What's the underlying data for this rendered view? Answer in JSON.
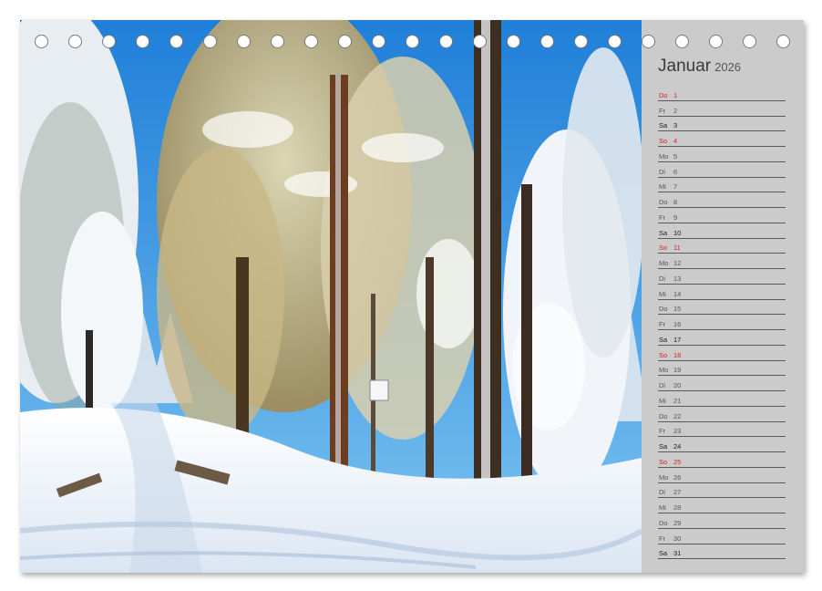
{
  "calendar": {
    "month": "Januar",
    "year": "2026",
    "days": [
      {
        "dn": "Do",
        "d": "1",
        "type": "sun"
      },
      {
        "dn": "Fr",
        "d": "2",
        "type": ""
      },
      {
        "dn": "Sa",
        "d": "3",
        "type": "sat"
      },
      {
        "dn": "So",
        "d": "4",
        "type": "sun"
      },
      {
        "dn": "Mo",
        "d": "5",
        "type": ""
      },
      {
        "dn": "Di",
        "d": "6",
        "type": ""
      },
      {
        "dn": "Mi",
        "d": "7",
        "type": ""
      },
      {
        "dn": "Do",
        "d": "8",
        "type": ""
      },
      {
        "dn": "Fr",
        "d": "9",
        "type": ""
      },
      {
        "dn": "Sa",
        "d": "10",
        "type": "sat"
      },
      {
        "dn": "So",
        "d": "11",
        "type": "sun"
      },
      {
        "dn": "Mo",
        "d": "12",
        "type": ""
      },
      {
        "dn": "Di",
        "d": "13",
        "type": ""
      },
      {
        "dn": "Mi",
        "d": "14",
        "type": ""
      },
      {
        "dn": "Do",
        "d": "15",
        "type": ""
      },
      {
        "dn": "Fr",
        "d": "16",
        "type": ""
      },
      {
        "dn": "Sa",
        "d": "17",
        "type": "sat"
      },
      {
        "dn": "So",
        "d": "18",
        "type": "sun"
      },
      {
        "dn": "Mo",
        "d": "19",
        "type": ""
      },
      {
        "dn": "Di",
        "d": "20",
        "type": ""
      },
      {
        "dn": "Mi",
        "d": "21",
        "type": ""
      },
      {
        "dn": "Do",
        "d": "22",
        "type": ""
      },
      {
        "dn": "Fr",
        "d": "23",
        "type": ""
      },
      {
        "dn": "Sa",
        "d": "24",
        "type": "sat"
      },
      {
        "dn": "So",
        "d": "25",
        "type": "sun"
      },
      {
        "dn": "Mo",
        "d": "26",
        "type": ""
      },
      {
        "dn": "Di",
        "d": "27",
        "type": ""
      },
      {
        "dn": "Mi",
        "d": "28",
        "type": ""
      },
      {
        "dn": "Do",
        "d": "29",
        "type": ""
      },
      {
        "dn": "Fr",
        "d": "30",
        "type": ""
      },
      {
        "dn": "Sa",
        "d": "31",
        "type": "sat"
      }
    ]
  },
  "binding": {
    "ring_count": 23
  },
  "photo": {
    "subject": "snowy-forest-icon",
    "sky_color": "#2a8fe0",
    "snow_color": "#f2f6fb"
  }
}
